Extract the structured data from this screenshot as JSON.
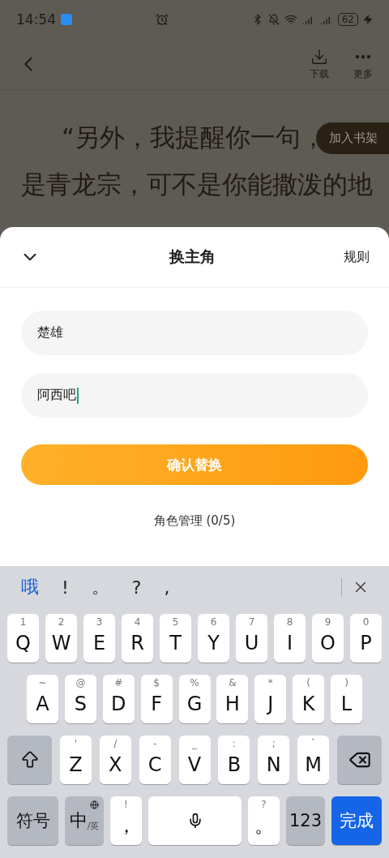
{
  "status_bar": {
    "time": "14:54",
    "battery": "62"
  },
  "header": {
    "actions": [
      {
        "kind": "download",
        "label": "下载"
      },
      {
        "kind": "more",
        "label": "更多"
      }
    ]
  },
  "reader": {
    "lines": [
      "“另外，我提醒你一句，",
      "是青龙宗，可不是你能撒泼的地"
    ],
    "shelf_button": "加入书架"
  },
  "sheet": {
    "title": "换主角",
    "rules": "规则",
    "fields": [
      {
        "value": "楚雄",
        "focused": false
      },
      {
        "value": "阿西吧",
        "focused": true
      }
    ],
    "confirm": "确认替换",
    "manage": "角色管理 (0/5)"
  },
  "keyboard": {
    "candidates": [
      {
        "text": "哦",
        "selected": true
      },
      {
        "text": "!",
        "selected": false
      },
      {
        "text": "。",
        "selected": false
      },
      {
        "text": "?",
        "selected": false
      },
      {
        "text": ",",
        "selected": false
      }
    ],
    "rows": [
      {
        "keys": [
          {
            "kind": "letter",
            "label": "Q",
            "hint": "1"
          },
          {
            "kind": "letter",
            "label": "W",
            "hint": "2"
          },
          {
            "kind": "letter",
            "label": "E",
            "hint": "3"
          },
          {
            "kind": "letter",
            "label": "R",
            "hint": "4"
          },
          {
            "kind": "letter",
            "label": "T",
            "hint": "5"
          },
          {
            "kind": "letter",
            "label": "Y",
            "hint": "6"
          },
          {
            "kind": "letter",
            "label": "U",
            "hint": "7"
          },
          {
            "kind": "letter",
            "label": "I",
            "hint": "8"
          },
          {
            "kind": "letter",
            "label": "O",
            "hint": "9"
          },
          {
            "kind": "letter",
            "label": "P",
            "hint": "0"
          }
        ]
      },
      {
        "keys": [
          {
            "kind": "letter",
            "label": "A",
            "hint": "~"
          },
          {
            "kind": "letter",
            "label": "S",
            "hint": "@"
          },
          {
            "kind": "letter",
            "label": "D",
            "hint": "#"
          },
          {
            "kind": "letter",
            "label": "F",
            "hint": "$"
          },
          {
            "kind": "letter",
            "label": "G",
            "hint": "%"
          },
          {
            "kind": "letter",
            "label": "H",
            "hint": "&"
          },
          {
            "kind": "letter",
            "label": "J",
            "hint": "*"
          },
          {
            "kind": "letter",
            "label": "K",
            "hint": "("
          },
          {
            "kind": "letter",
            "label": "L",
            "hint": ")"
          }
        ]
      },
      {
        "keys": [
          {
            "kind": "shift"
          },
          {
            "kind": "letter",
            "label": "Z",
            "hint": "'"
          },
          {
            "kind": "letter",
            "label": "X",
            "hint": "/"
          },
          {
            "kind": "letter",
            "label": "C",
            "hint": "-"
          },
          {
            "kind": "letter",
            "label": "V",
            "hint": "_"
          },
          {
            "kind": "letter",
            "label": "B",
            "hint": ":"
          },
          {
            "kind": "letter",
            "label": "N",
            "hint": ";"
          },
          {
            "kind": "letter",
            "label": "M",
            "hint": "`"
          },
          {
            "kind": "backspace"
          }
        ]
      },
      {
        "keys": [
          {
            "kind": "symbols",
            "label": "符号"
          },
          {
            "kind": "lang",
            "label": "中",
            "hint": "/英"
          },
          {
            "kind": "punct",
            "label": "，",
            "hint": "!"
          },
          {
            "kind": "space"
          },
          {
            "kind": "punct",
            "label": "。",
            "hint": "?"
          },
          {
            "kind": "num",
            "label": "123"
          },
          {
            "kind": "done",
            "label": "完成"
          }
        ]
      }
    ]
  }
}
